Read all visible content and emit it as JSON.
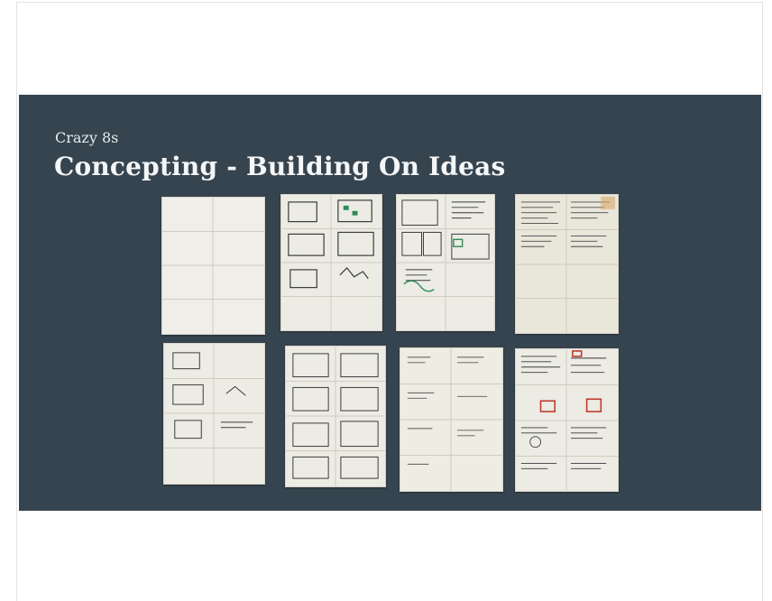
{
  "slide": {
    "kicker": "Crazy 8s",
    "title": "Concepting - Building On Ideas",
    "background": "#36444f"
  },
  "sketches": {
    "paper_color": "#ecebe4",
    "ink_color": "#3a3a3a",
    "marker_colors": [
      "#2e8b57",
      "#c0392b"
    ]
  }
}
